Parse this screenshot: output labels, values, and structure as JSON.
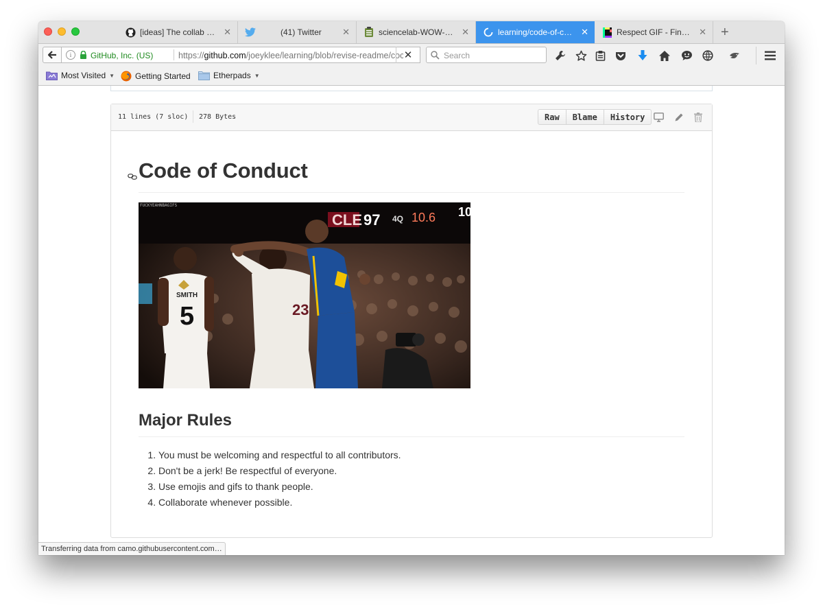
{
  "tabs": [
    {
      "title": "[ideas] The collab co…",
      "icon": "github-icon"
    },
    {
      "title": "(41) Twitter",
      "icon": "twitter-icon"
    },
    {
      "title": "sciencelab-WOW-git…",
      "icon": "etherpad-icon"
    },
    {
      "title": "learning/code-of-co…",
      "icon": "loading-icon",
      "active": true
    },
    {
      "title": "Respect GIF - Find …",
      "icon": "giphy-icon"
    }
  ],
  "navbar": {
    "identity": "GitHub, Inc. (US)",
    "url_prefix": "https://",
    "url_domain": "github.com",
    "url_path": "/joeyklee/learning/blob/revise-readme/coc",
    "search_placeholder": "Search"
  },
  "bookmarks": [
    {
      "label": "Most Visited",
      "icon": "most-visited-folder-icon",
      "dropdown": true
    },
    {
      "label": "Getting Started",
      "icon": "firefox-icon",
      "dropdown": false
    },
    {
      "label": "Etherpads",
      "icon": "folder-icon",
      "dropdown": true
    }
  ],
  "file": {
    "lines": "11 lines (7 sloc)",
    "size": "278 Bytes",
    "buttons": {
      "raw": "Raw",
      "blame": "Blame",
      "history": "History"
    }
  },
  "markdown": {
    "h1": "Code of Conduct",
    "gif_watermark": "FUCKYEAHNBAGIFS",
    "h2": "Major Rules",
    "rules": [
      "You must be welcoming and respectful to all contributors.",
      "Don't be a jerk! Be respectful of everyone.",
      "Use emojis and gifs to thank people.",
      "Collaborate whenever possible."
    ]
  },
  "gif_scoreboard": {
    "team": "CLE",
    "score": "97",
    "period": "4Q",
    "clock": "10.6",
    "other": "10"
  },
  "gif_jerseys": {
    "left_name": "SMITH",
    "left_number": "5",
    "middle": "23"
  },
  "status_text": "Transferring data from camo.githubusercontent.com…",
  "colors": {
    "active_tab": "#3c94ed",
    "secure_identity": "#1f8a1f",
    "download_arrow": "#1a8cf0"
  }
}
